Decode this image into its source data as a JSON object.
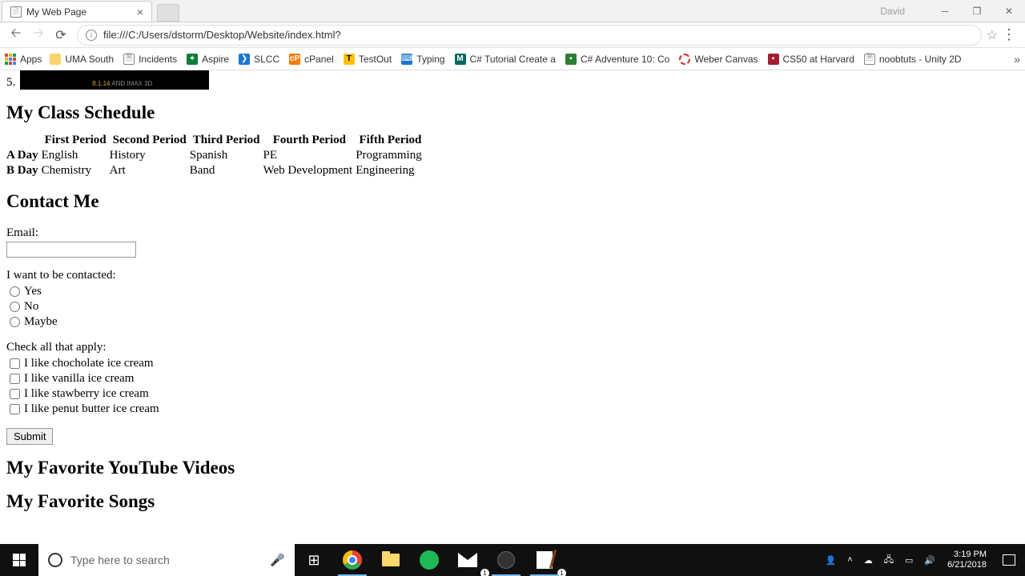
{
  "browser": {
    "tab_title": "My Web Page",
    "user": "David",
    "url": "file:///C:/Users/dstorm/Desktop/Website/index.html?",
    "apps_label": "Apps",
    "bookmarks": [
      {
        "label": "UMA South"
      },
      {
        "label": "Incidents"
      },
      {
        "label": "Aspire"
      },
      {
        "label": "SLCC"
      },
      {
        "label": "cPanel"
      },
      {
        "label": "TestOut"
      },
      {
        "label": "Typing"
      },
      {
        "label": "C# Tutorial Create a"
      },
      {
        "label": "C# Adventure 10: Co"
      },
      {
        "label": "Weber Canvas"
      },
      {
        "label": "CS50 at Harvard"
      },
      {
        "label": "noobtuts - Unity 2D"
      }
    ]
  },
  "page": {
    "ol_number": "5.",
    "dark_box_gold": "8.1.14",
    "dark_box_gray": "AND IMAX 3D",
    "schedule_heading": "My Class Schedule",
    "schedule": {
      "headers": [
        "First Period",
        "Second Period",
        "Third Period",
        "Fourth Period",
        "Fifth Period"
      ],
      "rows": [
        {
          "label": "A Day",
          "cells": [
            "English",
            "History",
            "Spanish",
            "PE",
            "Programming"
          ]
        },
        {
          "label": "B Day",
          "cells": [
            "Chemistry",
            "Art",
            "Band",
            "Web Development",
            "Engineering"
          ]
        }
      ]
    },
    "contact_heading": "Contact Me",
    "email_label": "Email:",
    "contacted_label": "I want to be contacted:",
    "radio_options": [
      "Yes",
      "No",
      "Maybe"
    ],
    "checkbox_label": "Check all that apply:",
    "checkbox_options": [
      "I like chocholate ice cream",
      "I like vanilla ice cream",
      "I like stawberry ice cream",
      "I like penut butter ice cream"
    ],
    "submit_label": "Submit",
    "videos_heading": "My Favorite YouTube Videos",
    "songs_heading": "My Favorite Songs"
  },
  "taskbar": {
    "search_placeholder": "Type here to search",
    "time": "3:19 PM",
    "date": "6/21/2018",
    "mail_badge": "1",
    "np_badge": "1"
  }
}
